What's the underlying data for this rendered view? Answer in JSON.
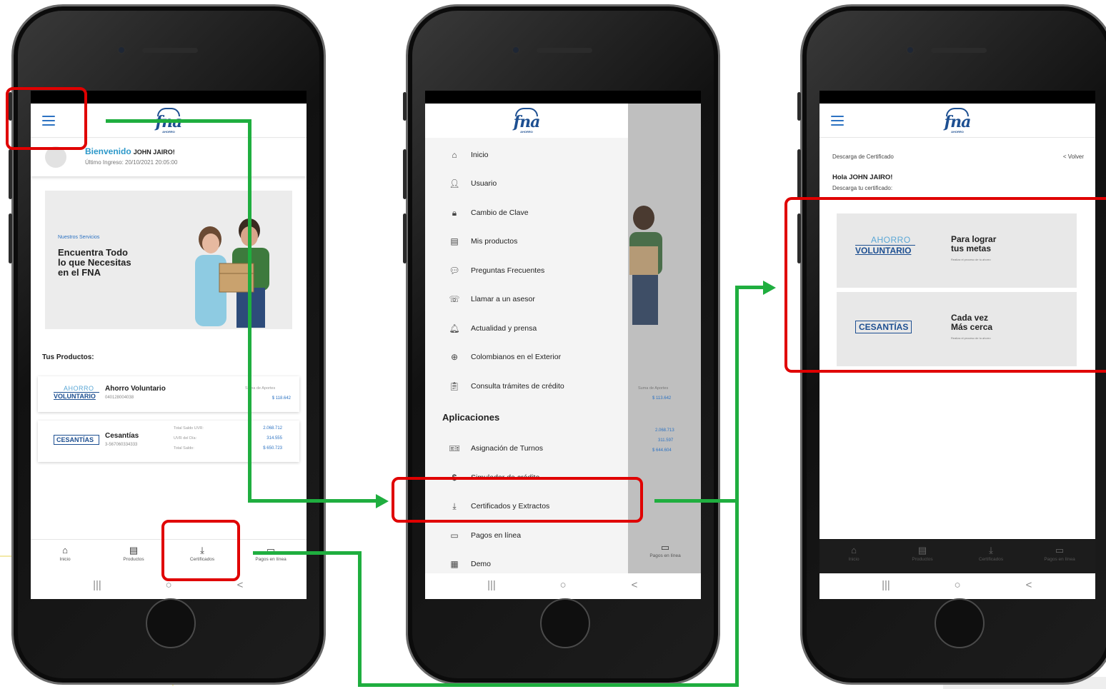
{
  "colors": {
    "brand_blue": "#1d4f91",
    "accent_cyan": "#2c98c9",
    "highlight_red": "#e00000",
    "flow_green": "#1fae3f"
  },
  "logo": {
    "word": "fna",
    "sub": "AHORRO"
  },
  "phone1": {
    "welcome": {
      "greeting": "Bienvenido",
      "name": "JOHN JAIRO!",
      "last_login": "Último Ingreso: 20/10/2021 20:05:00"
    },
    "banner": {
      "small": "Nuestros Servicios",
      "headline": "Encuentra Todo lo que Necesitas en el FNA"
    },
    "products_title": "Tus Productos:",
    "products": [
      {
        "logo_top": "AHORRO",
        "logo_bottom": "VOLUNTARIO",
        "name": "Ahorro Voluntario",
        "number": "040128004038",
        "label1": "Suma de Aportes",
        "value1": "$ 118.642"
      },
      {
        "logo_text": "CESANTÍAS",
        "name": "Cesantías",
        "number": "3-567060334333",
        "label1": "Total Saldo UVR:",
        "label2": "UVR del Día:",
        "label3": "Total Saldo:",
        "value1": "2.068.712",
        "value2": "314.555",
        "value3": "$ 650.723"
      }
    ]
  },
  "bottom_nav": [
    {
      "label": "Inicio",
      "icon": "home-icon"
    },
    {
      "label": "Productos",
      "icon": "document-icon"
    },
    {
      "label": "Certificados",
      "icon": "download-icon"
    },
    {
      "label": "Pagos en línea",
      "icon": "card-icon"
    }
  ],
  "android_bar": {
    "recents": "|||",
    "home": "○",
    "back": "<"
  },
  "phone2": {
    "menu": [
      {
        "label": "Inicio",
        "icon": "home-icon"
      },
      {
        "label": "Usuario",
        "icon": "user-icon"
      },
      {
        "label": "Cambio de Clave",
        "icon": "lock-icon"
      },
      {
        "label": "Mis productos",
        "icon": "document-icon"
      },
      {
        "label": "Preguntas Frecuentes",
        "icon": "chat-icon"
      },
      {
        "label": "Llamar a un asesor",
        "icon": "phone-icon"
      },
      {
        "label": "Actualidad y prensa",
        "icon": "bell-icon"
      },
      {
        "label": "Colombianos en el Exterior",
        "icon": "globe-icon"
      },
      {
        "label": "Consulta trámites de crédito",
        "icon": "clipboard-icon"
      }
    ],
    "section_title": "Aplicaciones",
    "apps": [
      {
        "label": "Asignación de Turnos",
        "icon": "ticket-icon"
      },
      {
        "label": "Simulador de crédito",
        "icon": "dollar-icon"
      },
      {
        "label": "Certificados y Extractos",
        "icon": "download-icon"
      },
      {
        "label": "Pagos en línea",
        "icon": "card-icon"
      },
      {
        "label": "Demo",
        "icon": "building-icon"
      }
    ],
    "bg_values": {
      "suma_label": "Suma de Aportes",
      "suma": "$ 113.642",
      "v1": "2.068.713",
      "v2": "311.597",
      "v3": "$ 644.604",
      "nav_label": "Pagos en línea"
    }
  },
  "phone3": {
    "header": "Descarga de Certificado",
    "back": "< Volver",
    "hola": "Hola JOHN JAIRO!",
    "desc": "Descarga tu certificado:",
    "cards": [
      {
        "logo_top": "AHORRO",
        "logo_bottom": "VOLUNTARIO",
        "title1": "Para lograr",
        "title2": "tus metas",
        "sub": "Realiza el proceso de tu ahorro"
      },
      {
        "logo_text": "CESANTÍAS",
        "title1": "Cada vez",
        "title2": "Más cerca",
        "sub": "Realiza el proceso de tu ahorro"
      }
    ]
  }
}
